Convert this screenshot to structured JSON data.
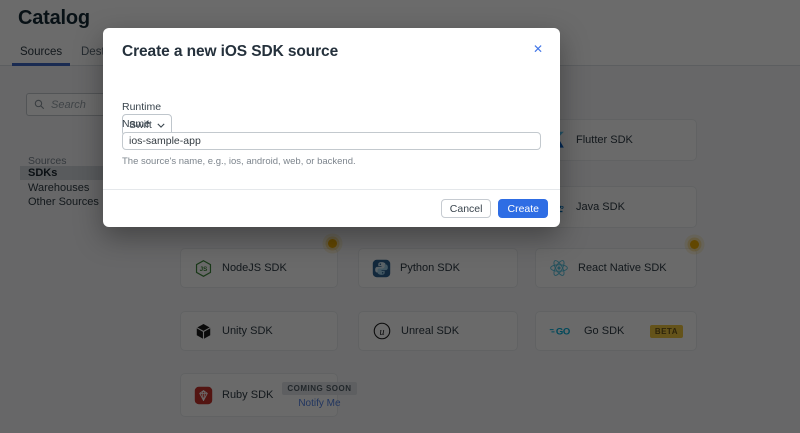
{
  "header": {
    "title": "Catalog",
    "tabs": [
      {
        "label": "Sources",
        "active": true
      },
      {
        "label": "Destinations",
        "active": false
      }
    ]
  },
  "sidebar": {
    "search_placeholder": "Search",
    "section_label": "Sources",
    "items": [
      {
        "label": "SDKs",
        "active": true
      },
      {
        "label": "Warehouses",
        "active": false
      },
      {
        "label": "Other Sources",
        "active": false
      }
    ]
  },
  "catalog": {
    "cards": [
      {
        "id": "flutter",
        "label": "Flutter SDK"
      },
      {
        "id": "java",
        "label": "Java SDK"
      },
      {
        "id": "nodejs",
        "label": "NodeJS SDK"
      },
      {
        "id": "python",
        "label": "Python SDK"
      },
      {
        "id": "react-native",
        "label": "React Native SDK"
      },
      {
        "id": "unity",
        "label": "Unity SDK"
      },
      {
        "id": "unreal",
        "label": "Unreal SDK"
      },
      {
        "id": "go",
        "label": "Go SDK",
        "badge": "BETA"
      },
      {
        "id": "ruby",
        "label": "Ruby SDK",
        "badge": "COMING SOON",
        "link": "Notify Me"
      }
    ]
  },
  "modal": {
    "title": "Create a new iOS SDK source",
    "close_glyph": "✕",
    "runtime": {
      "label": "Runtime",
      "selected": "Swift"
    },
    "name": {
      "label": "Name",
      "value": "ios-sample-app",
      "helper": "The source's name, e.g., ios, android, web, or backend."
    },
    "actions": {
      "cancel": "Cancel",
      "create": "Create"
    }
  },
  "colors": {
    "accent_blue": "#2e6de4",
    "tab_underline_blue": "#3e66c4",
    "close_icon_blue": "#4377e8",
    "notify_link_blue": "#4f7fe3",
    "beta_badge_bg": "#efc53f",
    "coming_soon_badge_bg": "#dfe3e6",
    "pulse_dot_gold": "#eaaa00",
    "nodejs_green": "#3c873a",
    "python_blue": "#2d618f",
    "react_blue": "#53c1de",
    "go_cyan": "#00acd7",
    "ruby_red": "#c6342d",
    "flutter_blue": "#54c5f8",
    "overlay": "rgba(0,0,0,0.58)"
  }
}
